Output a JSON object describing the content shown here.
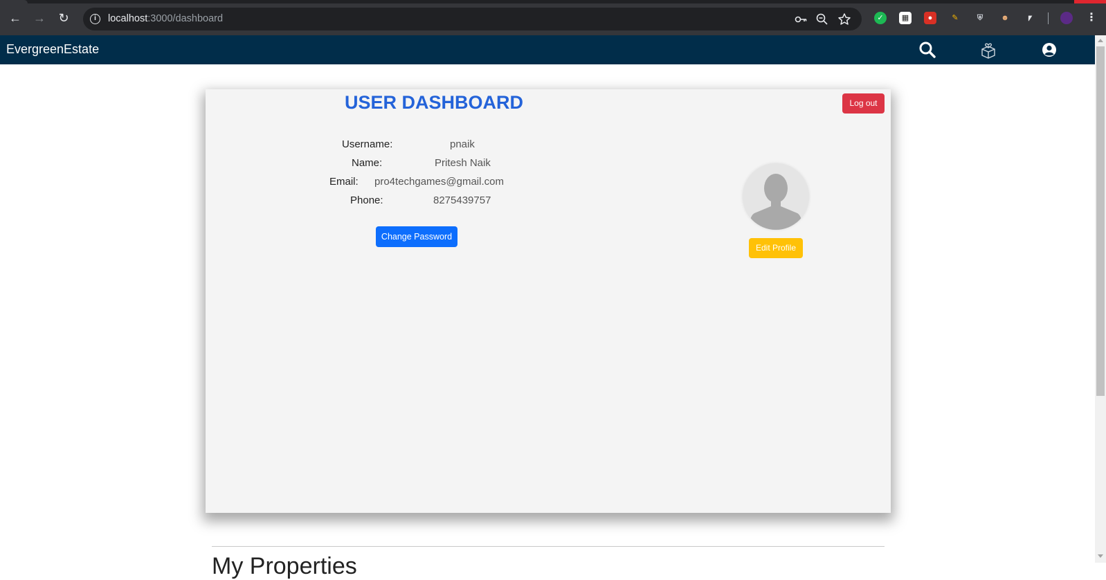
{
  "browser": {
    "url_host": "localhost",
    "url_path": ":3000/dashboard"
  },
  "navbar": {
    "brand": "EvergreenEstate"
  },
  "dashboard": {
    "title": "USER DASHBOARD",
    "logout_label": "Log out",
    "fields": [
      {
        "label": "Username:",
        "value": "pnaik"
      },
      {
        "label": "Name:",
        "value": "Pritesh Naik"
      },
      {
        "label": "Email:",
        "value": "pro4techgames@gmail.com"
      },
      {
        "label": "Phone:",
        "value": "8275439757"
      }
    ],
    "change_password_label": "Change Password",
    "edit_profile_label": "Edit Profile"
  },
  "section": {
    "title": "My Properties"
  },
  "colors": {
    "navbar": "#012d4a",
    "title": "#2463d9",
    "logout": "#dc3545",
    "primary": "#0d6efd",
    "warning": "#ffc107"
  }
}
